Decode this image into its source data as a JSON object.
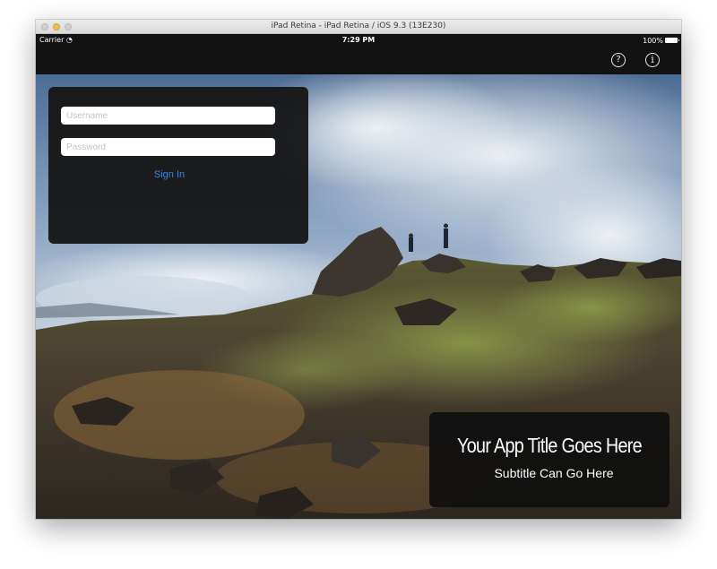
{
  "window": {
    "title": "iPad Retina - iPad Retina / iOS 9.3 (13E230)"
  },
  "status_bar": {
    "carrier": "Carrier",
    "time": "7:29 PM",
    "battery": "100%"
  },
  "nav": {
    "help_icon": "help-circle-icon",
    "help_glyph": "?",
    "info_icon": "info-circle-icon",
    "info_glyph": "i"
  },
  "login": {
    "username_placeholder": "Username",
    "password_placeholder": "Password",
    "signin_label": "Sign In",
    "signin_color": "#2f8ae8"
  },
  "hero": {
    "title": "Your App Title Goes Here",
    "subtitle": "Subtitle Can Go Here"
  }
}
